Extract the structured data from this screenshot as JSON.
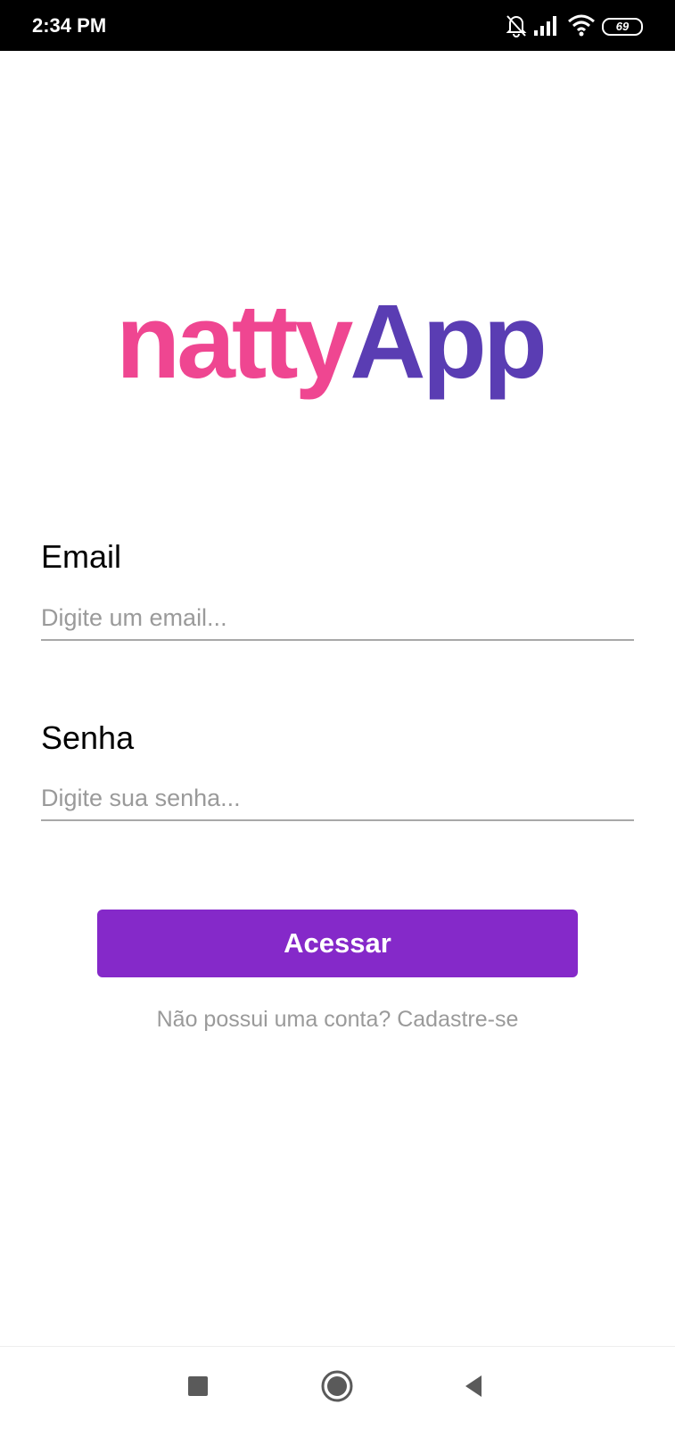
{
  "status_bar": {
    "time": "2:34 PM",
    "battery_level": "69",
    "icons": [
      "bell-off-icon",
      "signal-icon",
      "wifi-icon",
      "battery-icon"
    ]
  },
  "logo": {
    "part1": "natty",
    "part2": "App",
    "colors": {
      "part1": "#ef4691",
      "part2": "#5a3db3"
    }
  },
  "form": {
    "email_label": "Email",
    "email_placeholder": "Digite um email...",
    "email_value": "",
    "password_label": "Senha",
    "password_placeholder": "Digite sua senha...",
    "password_value": "",
    "submit_label": "Acessar",
    "signup_text": "Não possui uma conta? Cadastre-se"
  },
  "colors": {
    "accent": "#8529c9",
    "muted_text": "#9a9a9a"
  },
  "nav_bar": {
    "icons": [
      "recents-square-icon",
      "home-circle-icon",
      "back-triangle-icon"
    ]
  }
}
